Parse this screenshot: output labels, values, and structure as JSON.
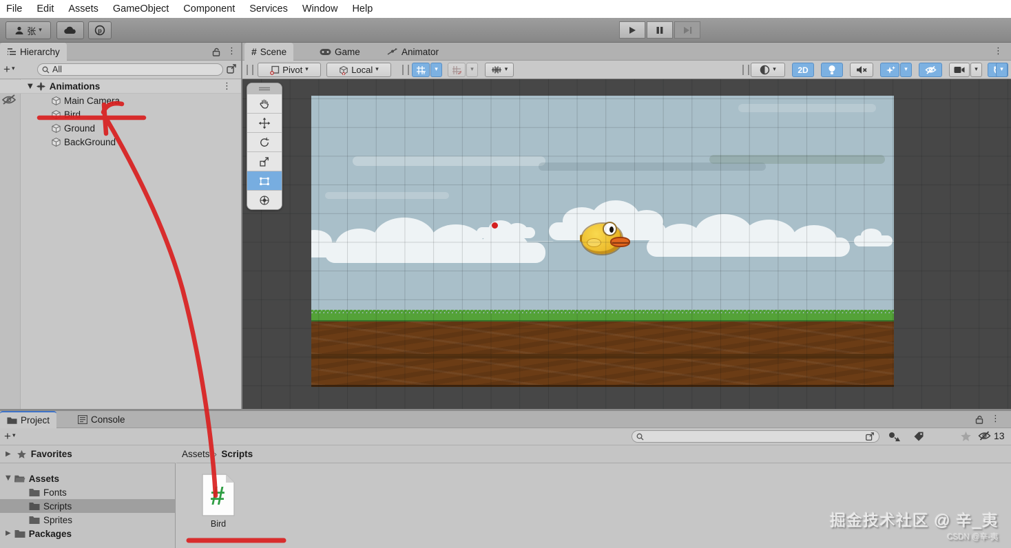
{
  "menu": {
    "items": [
      "File",
      "Edit",
      "Assets",
      "GameObject",
      "Component",
      "Services",
      "Window",
      "Help"
    ]
  },
  "topbar": {
    "account_label": "张",
    "play_controls": {
      "play": "play",
      "pause": "pause",
      "step": "step (disabled)"
    }
  },
  "hierarchy": {
    "tab_label": "Hierarchy",
    "create_label": "+",
    "search_label": "All",
    "scene_name": "Animations",
    "items": [
      {
        "label": "Main Camera"
      },
      {
        "label": "Bird"
      },
      {
        "label": "Ground"
      },
      {
        "label": "BackGround"
      }
    ]
  },
  "scene_view": {
    "tabs": [
      {
        "label": "Scene",
        "active": true
      },
      {
        "label": "Game",
        "active": false
      },
      {
        "label": "Animator",
        "active": false
      }
    ],
    "pivot_label": "Pivot",
    "handle_label": "Local",
    "two_d_label": "2D",
    "tools": [
      "hand",
      "move",
      "rotate",
      "scale",
      "rect (selected)",
      "transform"
    ]
  },
  "project": {
    "tabs": [
      {
        "label": "Project",
        "active": true
      },
      {
        "label": "Console",
        "active": false
      }
    ],
    "create_label": "+",
    "favorites_label": "Favorites",
    "breadcrumb": {
      "root": "Assets",
      "current": "Scripts"
    },
    "tree": [
      {
        "label": "Assets"
      },
      {
        "label": "Fonts"
      },
      {
        "label": "Scripts"
      },
      {
        "label": "Sprites"
      },
      {
        "label": "Packages"
      }
    ],
    "asset_name": "Bird",
    "hidden_count": "13"
  },
  "watermark": {
    "line1": "掘金技术社区 @ 辛_夷",
    "line2": "CSDN @辛-夷"
  },
  "glyphs": {
    "caret": "▾",
    "kebab": "⋮",
    "plus": "+",
    "hash": "#",
    "breadcrumb_sep": "›"
  },
  "colors": {
    "accent_blue": "#7cb1e2",
    "tab_active_line": "#3d72c8",
    "annotation_red": "#d91f1f",
    "script_icon_green": "#2f9e44",
    "sky": "#a9bfc9",
    "grass": "#54a238",
    "dirt": "#6b3c15"
  }
}
